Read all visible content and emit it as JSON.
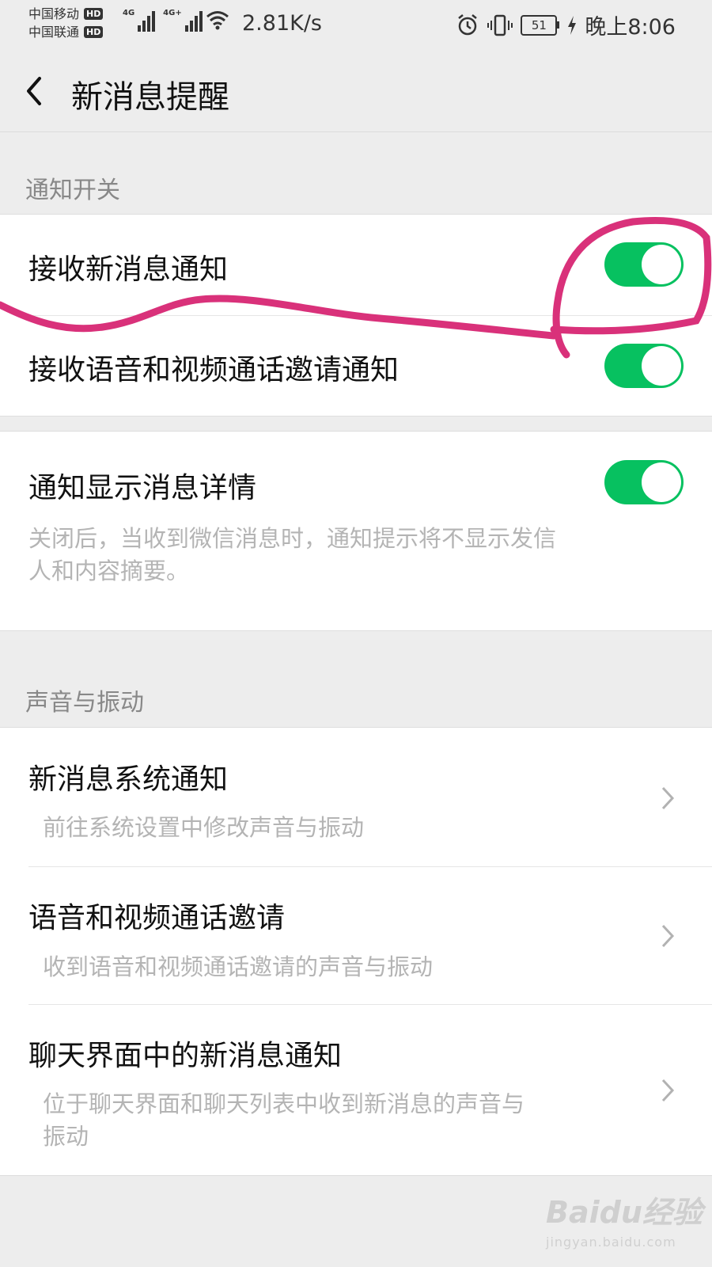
{
  "status_bar": {
    "carrier1": "中国移动",
    "carrier2": "中国联通",
    "hd_badge": "HD",
    "network1": "4G",
    "network2": "4G+",
    "speed": "2.81K/s",
    "battery": "51",
    "time": "晚上8:06",
    "icons": [
      "signal-icon",
      "wifi-icon",
      "alarm-icon",
      "vibrate-icon",
      "battery-icon",
      "charging-icon"
    ]
  },
  "header": {
    "title": "新消息提醒",
    "back_icon": "back-arrow-icon"
  },
  "section_notify": {
    "label": "通知开关",
    "items": [
      {
        "label": "接收新消息通知",
        "toggle_on": true
      },
      {
        "label": "接收语音和视频通话邀请通知",
        "toggle_on": true
      }
    ]
  },
  "details": {
    "label": "通知显示消息详情",
    "toggle_on": true,
    "desc_line1": "关闭后，当收到微信消息时，通知提示将不显示发信",
    "desc_line2": "人和内容摘要。"
  },
  "section_sound": {
    "label": "声音与振动",
    "items": [
      {
        "title": "新消息系统通知",
        "desc1": "前往系统设置中修改声音与振动",
        "desc2": ""
      },
      {
        "title": "语音和视频通话邀请",
        "desc1": "收到语音和视频通话邀请的声音与振动",
        "desc2": ""
      },
      {
        "title": "聊天界面中的新消息通知",
        "desc1": "位于聊天界面和聊天列表中收到新消息的声音与",
        "desc2": "振动"
      }
    ]
  },
  "colors": {
    "toggle_on": "#07c160",
    "annotation": "#d9317a",
    "page_bg": "#ededed"
  },
  "watermark": {
    "brand": "Baidu经验",
    "url": "jingyan.baidu.com"
  }
}
